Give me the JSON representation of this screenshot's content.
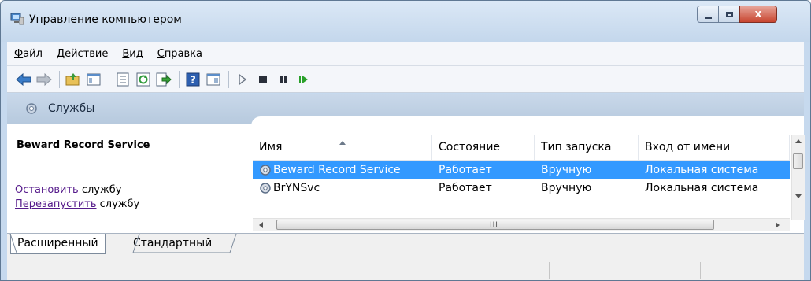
{
  "window": {
    "title": "Управление компьютером",
    "close_glyph": "x"
  },
  "menu": {
    "items": [
      {
        "accel": "Ф",
        "rest": "айл"
      },
      {
        "accel": "Д",
        "rest": "ействие"
      },
      {
        "accel": "В",
        "rest": "ид"
      },
      {
        "accel": "С",
        "rest": "правка"
      }
    ]
  },
  "toolbar": {
    "icons": [
      "back-icon",
      "forward-icon",
      "up-folder-icon",
      "show-tree-icon",
      "properties-icon",
      "refresh-icon",
      "export-icon",
      "help-icon",
      "view-icon",
      "start-icon",
      "stop-icon",
      "pause-icon",
      "resume-icon"
    ]
  },
  "panel": {
    "header": "Службы",
    "selected_service": "Beward Record Service",
    "actions": [
      {
        "link": "Остановить",
        "suffix": " службу"
      },
      {
        "link": "Перезапустить",
        "suffix": " службу"
      }
    ]
  },
  "table": {
    "columns": [
      "Имя",
      "Состояние",
      "Тип запуска",
      "Вход от имени"
    ],
    "rows": [
      {
        "name": "Beward Record Service",
        "state": "Работает",
        "startup": "Вручную",
        "logon": "Локальная система",
        "selected": true
      },
      {
        "name": "BrYNSvc",
        "state": "Работает",
        "startup": "Вручную",
        "logon": "Локальная система",
        "selected": false
      }
    ],
    "hscroll_grip": "III"
  },
  "tabs": [
    "Расширенный",
    "Стандартный"
  ],
  "colors": {
    "selection": "#3399ff",
    "link": "#551a8b",
    "header_band": "#c9d8ea"
  }
}
